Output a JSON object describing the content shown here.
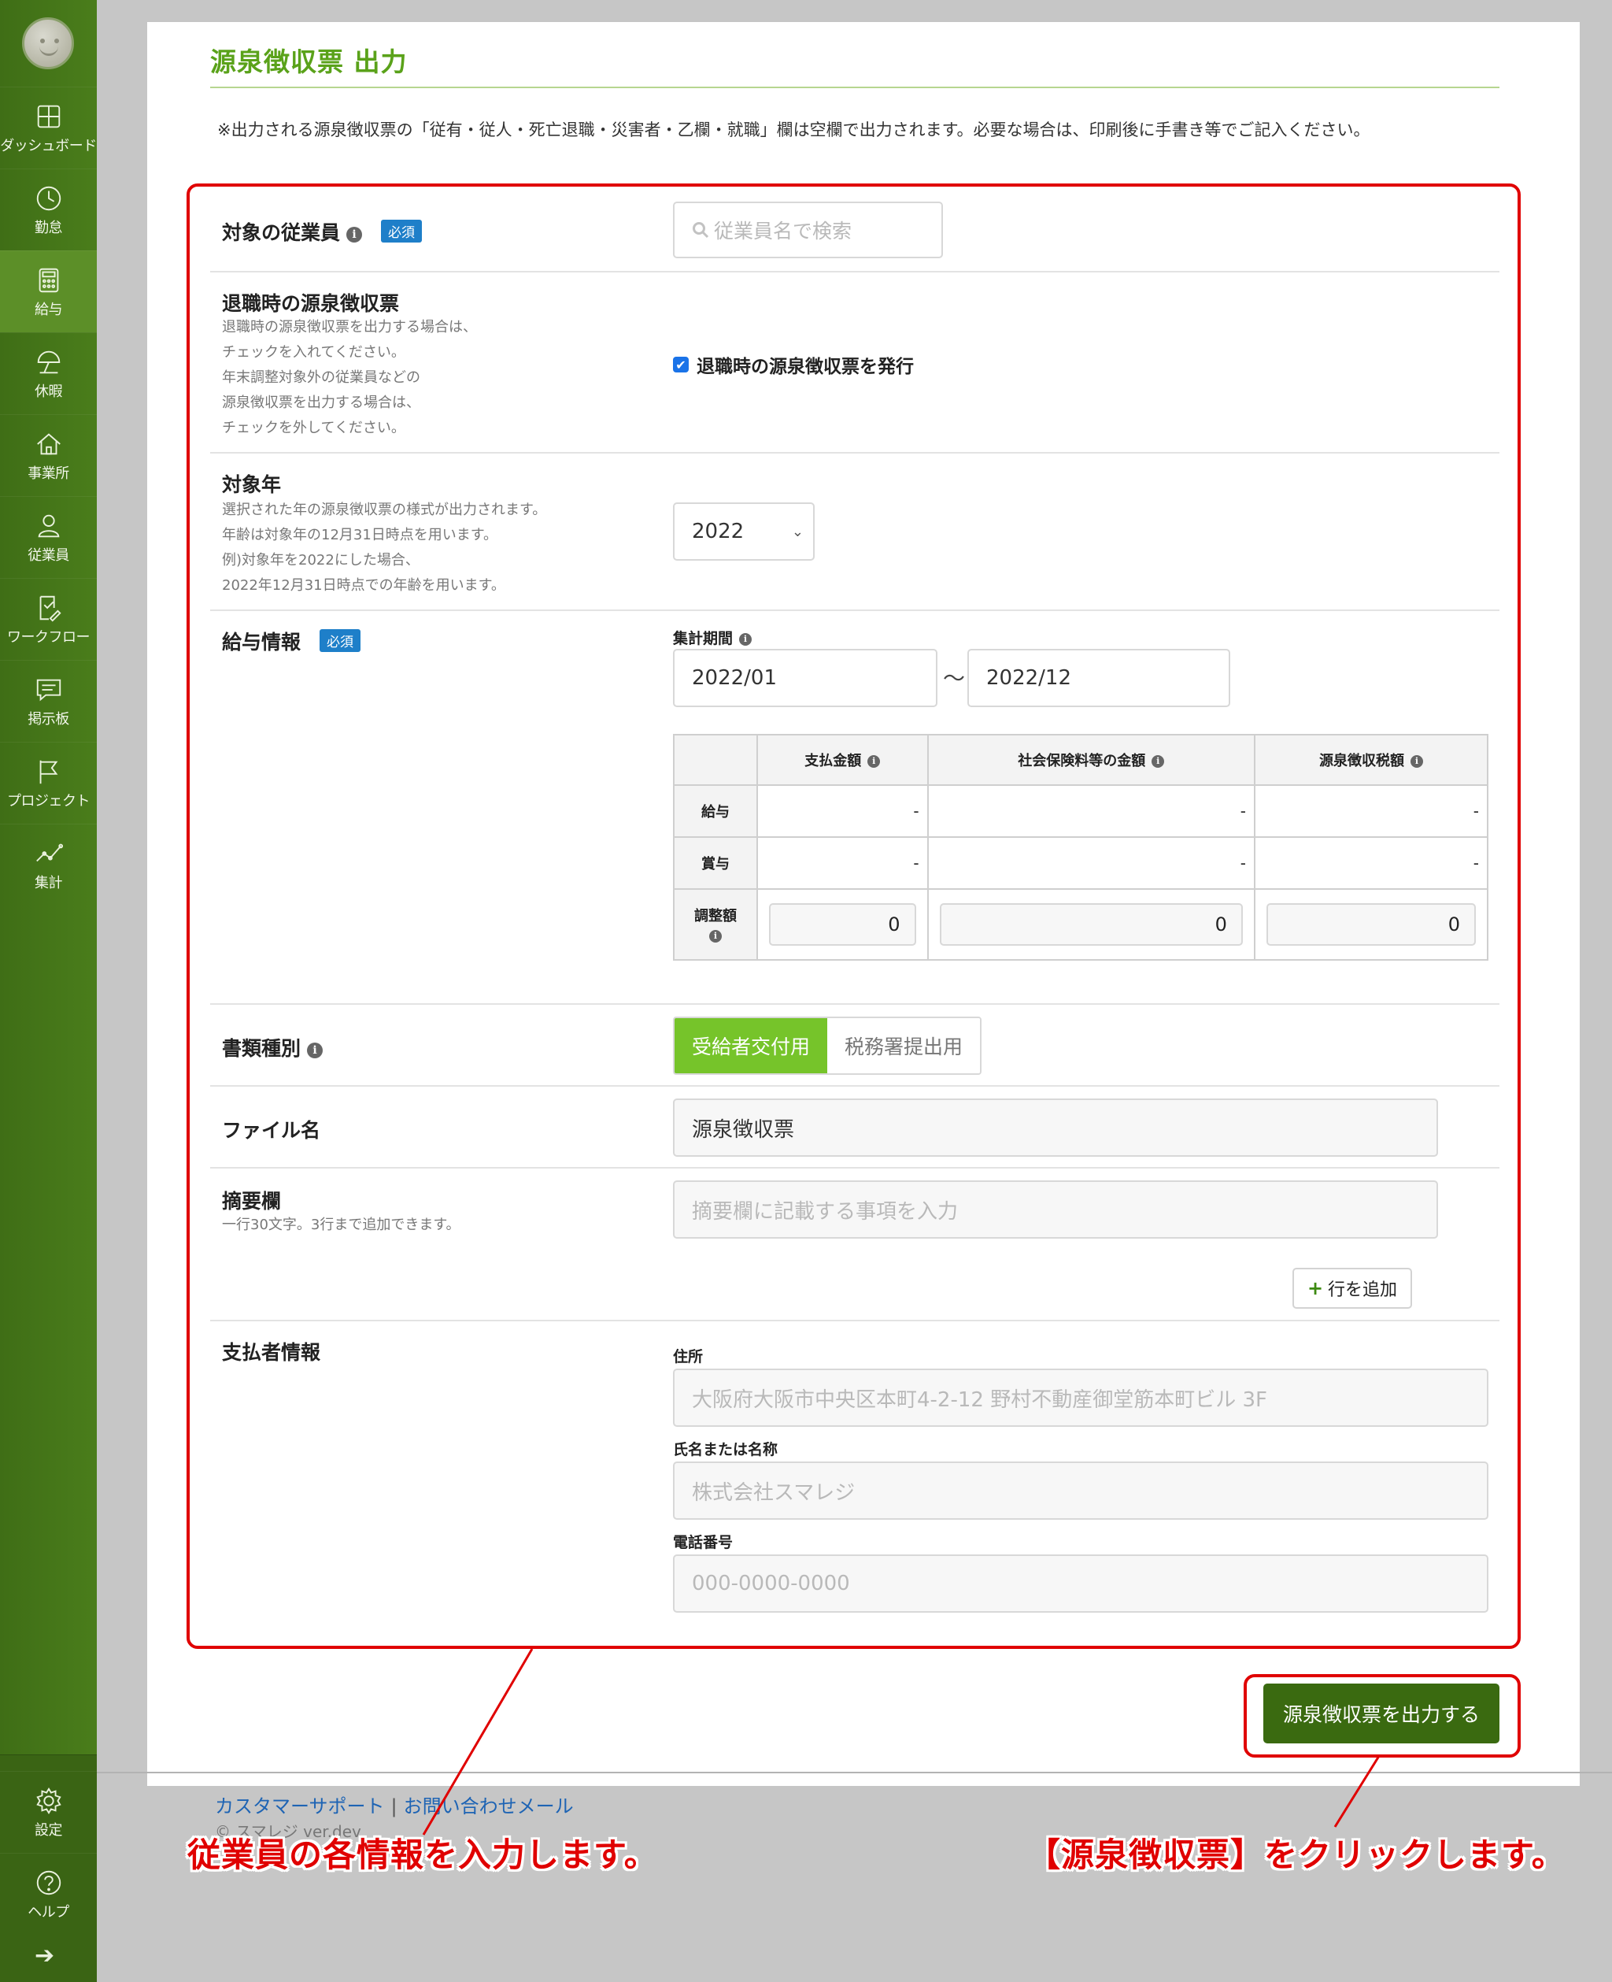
{
  "sidebar": {
    "items": [
      {
        "label": "ダッシュボード",
        "icon": "dashboard-icon"
      },
      {
        "label": "勤怠",
        "icon": "clock-icon"
      },
      {
        "label": "給与",
        "icon": "calculator-icon"
      },
      {
        "label": "休暇",
        "icon": "umbrella-icon"
      },
      {
        "label": "事業所",
        "icon": "home-icon"
      },
      {
        "label": "従業員",
        "icon": "person-icon"
      },
      {
        "label": "ワークフロー",
        "icon": "workflow-icon"
      },
      {
        "label": "掲示板",
        "icon": "chat-icon"
      },
      {
        "label": "プロジェクト",
        "icon": "flag-icon"
      },
      {
        "label": "集計",
        "icon": "chart-icon"
      }
    ],
    "bottom": [
      {
        "label": "設定",
        "icon": "gear-icon"
      },
      {
        "label": "ヘルプ",
        "icon": "help-icon"
      }
    ],
    "active": "給与",
    "accent": "#4a7d1b"
  },
  "page": {
    "title": "源泉徴収票 出力",
    "notice": "※出力される源泉徴収票の「従有・従人・死亡退職・災害者・乙欄・就職」欄は空欄で出力されます。必要な場合は、印刷後に手書き等でご記入ください。"
  },
  "required_badge": "必須",
  "employee": {
    "label": "対象の従業員",
    "search_placeholder": "従業員名で検索"
  },
  "retirement": {
    "label": "退職時の源泉徴収票",
    "help": [
      "退職時の源泉徴収票を出力する場合は、",
      "チェックを入れてください。",
      "年末調整対象外の従業員などの",
      "源泉徴収票を出力する場合は、",
      "チェックを外してください。"
    ],
    "checkbox_label": "退職時の源泉徴収票を発行",
    "checked": true
  },
  "target_year": {
    "label": "対象年",
    "help": [
      "選択された年の源泉徴収票の様式が出力されます。",
      "年齢は対象年の12月31日時点を用います。",
      "例)対象年を2022にした場合、",
      "2022年12月31日時点での年齢を用います。"
    ],
    "value": "2022"
  },
  "salary_info": {
    "label": "給与情報",
    "period_label": "集計期間",
    "period_from": "2022/01",
    "period_sep": "〜",
    "period_to": "2022/12",
    "columns": [
      "支払金額",
      "社会保険料等の金額",
      "源泉徴収税額"
    ],
    "rows": [
      {
        "label": "給与",
        "values": [
          "-",
          "-",
          "-"
        ]
      },
      {
        "label": "賞与",
        "values": [
          "-",
          "-",
          "-"
        ]
      }
    ],
    "adjust_label": "調整額",
    "adjust_values": [
      "0",
      "0",
      "0"
    ]
  },
  "doc_type": {
    "label": "書類種別",
    "options": [
      "受給者交付用",
      "税務署提出用"
    ],
    "selected": "受給者交付用"
  },
  "file_name": {
    "label": "ファイル名",
    "value": "源泉徴収票"
  },
  "remarks": {
    "label": "摘要欄",
    "help": "一行30文字。3行まで追加できます。",
    "placeholder": "摘要欄に記載する事項を入力",
    "add_row_label": "行を追加"
  },
  "payer": {
    "label": "支払者情報",
    "address_label": "住所",
    "address_placeholder": "大阪府大阪市中央区本町4-2-12 野村不動産御堂筋本町ビル 3F",
    "name_label": "氏名または名称",
    "name_placeholder": "株式会社スマレジ",
    "phone_label": "電話番号",
    "phone_placeholder": "000-0000-0000"
  },
  "output_button": "源泉徴収票を出力する",
  "footer": {
    "support": "カスタマーサポート",
    "separator": "|",
    "contact": "お問い合わせメール",
    "version": "© スマレジ ver.dev"
  },
  "annotations": {
    "left": "従業員の各情報を入力します。",
    "right": "【源泉徴収票】をクリックします。",
    "color": "#e00000"
  }
}
